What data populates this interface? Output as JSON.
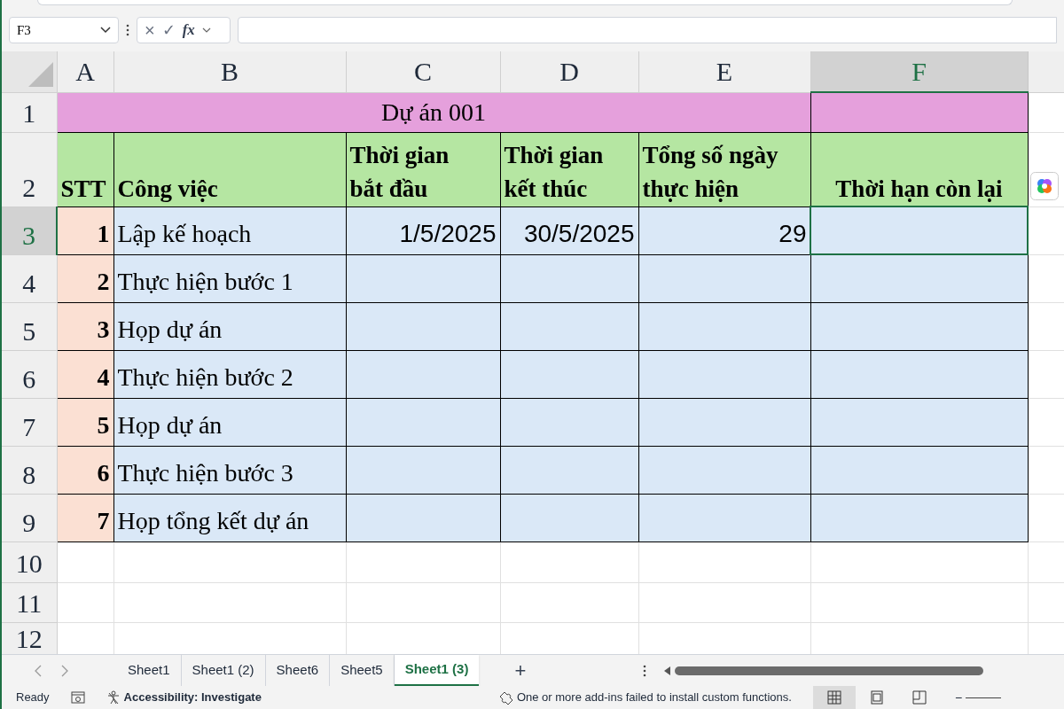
{
  "name_box": "F3",
  "formula_bar": {
    "cancel": "×",
    "enter": "✓",
    "function": "fx"
  },
  "column_headers": [
    {
      "label": "A",
      "selected": false
    },
    {
      "label": "B",
      "selected": false
    },
    {
      "label": "C",
      "selected": false
    },
    {
      "label": "D",
      "selected": false
    },
    {
      "label": "E",
      "selected": false
    },
    {
      "label": "F",
      "selected": true
    }
  ],
  "row_headers": [
    {
      "label": "1",
      "selected": false
    },
    {
      "label": "2",
      "selected": false
    },
    {
      "label": "3",
      "selected": true
    },
    {
      "label": "4",
      "selected": false
    },
    {
      "label": "5",
      "selected": false
    },
    {
      "label": "6",
      "selected": false
    },
    {
      "label": "7",
      "selected": false
    },
    {
      "label": "8",
      "selected": false
    },
    {
      "label": "9",
      "selected": false
    },
    {
      "label": "10",
      "selected": false
    },
    {
      "label": "11",
      "selected": false
    },
    {
      "label": "12",
      "selected": false
    }
  ],
  "title": "Dự án 001",
  "headers": [
    "STT",
    "Công việc",
    "Thời gian bắt đầu",
    "Thời gian kết thúc",
    "Tổng số ngày thực hiện",
    "Thời hạn còn lại"
  ],
  "tasks": [
    {
      "stt": "1",
      "name": "Lập kế hoạch",
      "start": "1/5/2025",
      "end": "30/5/2025",
      "days": "29"
    },
    {
      "stt": "2",
      "name": "Thực hiện bước 1"
    },
    {
      "stt": "3",
      "name": "Họp dự án"
    },
    {
      "stt": "4",
      "name": "Thực hiện bước 2"
    },
    {
      "stt": "5",
      "name": "Họp dự án"
    },
    {
      "stt": "6",
      "name": "Thực hiện bước 3"
    },
    {
      "stt": "7",
      "name": "Họp tổng kết dự án"
    }
  ],
  "sheet_tabs": [
    {
      "label": "Sheet1",
      "selected": false
    },
    {
      "label": "Sheet1 (2)",
      "selected": false
    },
    {
      "label": "Sheet6",
      "selected": false
    },
    {
      "label": "Sheet5",
      "selected": false
    },
    {
      "label": "Sheet1 (3)",
      "selected": true
    }
  ],
  "add_sheet": "+",
  "status_bar": {
    "mode": "Ready",
    "accessibility": "Accessibility: Investigate",
    "message": "One or more add-ins failed to install custom functions.",
    "views": [
      {
        "kind": "normal",
        "selected": true
      },
      {
        "kind": "page_layout",
        "selected": false
      },
      {
        "kind": "page_break",
        "selected": false
      }
    ],
    "zoom_out": "−"
  }
}
